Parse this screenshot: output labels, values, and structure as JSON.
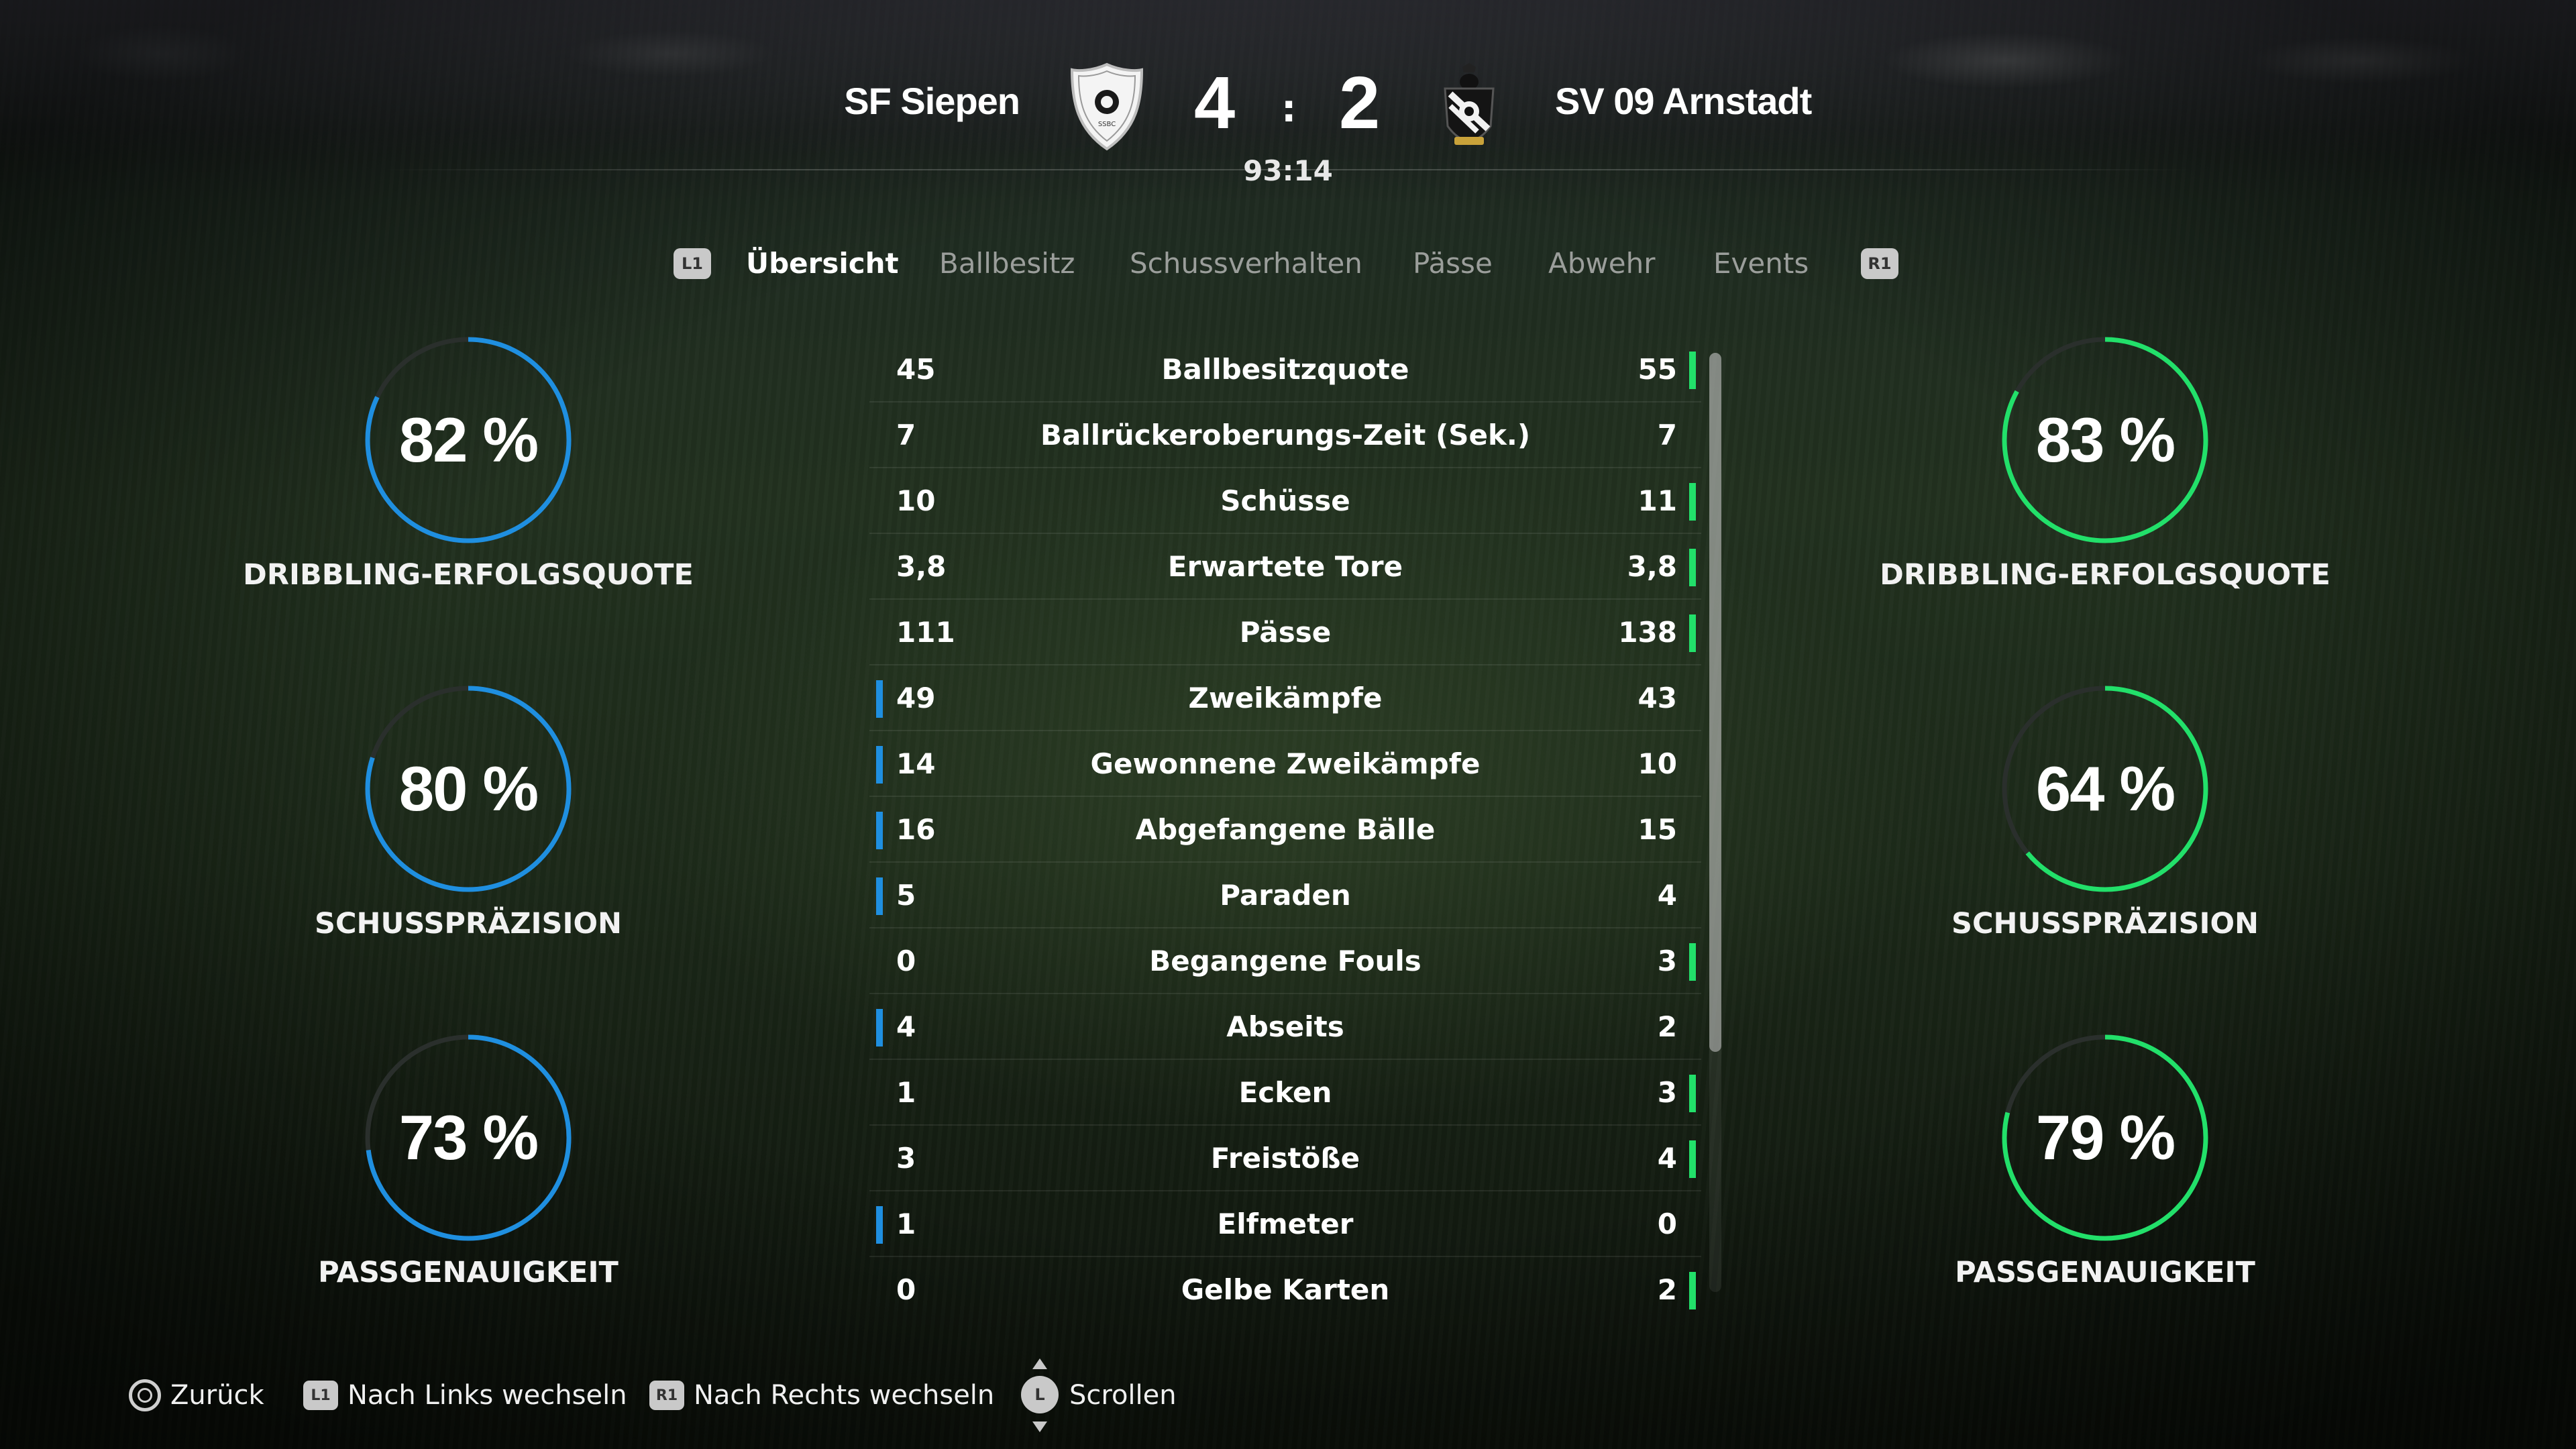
{
  "match": {
    "home_team": "SF Siepen",
    "away_team": "SV 09 Arnstadt",
    "home_score": "4",
    "away_score": "2",
    "separator": ":",
    "clock": "93:14"
  },
  "tabs": {
    "left_button": "L1",
    "right_button": "R1",
    "items": [
      "Übersicht",
      "Ballbesitz",
      "Schussverhalten",
      "Pässe",
      "Abwehr",
      "Events"
    ],
    "active": "Übersicht"
  },
  "home_rings": [
    {
      "value": "82 %",
      "percent": 82,
      "label": "DRIBBLING-ERFOLGSQUOTE"
    },
    {
      "value": "80 %",
      "percent": 80,
      "label": "SCHUSSPRÄZISION"
    },
    {
      "value": "73 %",
      "percent": 73,
      "label": "PASSGENAUIGKEIT"
    }
  ],
  "away_rings": [
    {
      "value": "83 %",
      "percent": 83,
      "label": "DRIBBLING-ERFOLGSQUOTE"
    },
    {
      "value": "64 %",
      "percent": 64,
      "label": "SCHUSSPRÄZISION"
    },
    {
      "value": "79 %",
      "percent": 79,
      "label": "PASSGENAUIGKEIT"
    }
  ],
  "stats": [
    {
      "home": "45",
      "label": "Ballbesitzquote",
      "away": "55",
      "leader": "away"
    },
    {
      "home": "7",
      "label": "Ballrückeroberungs-Zeit (Sek.)",
      "away": "7",
      "leader": "none"
    },
    {
      "home": "10",
      "label": "Schüsse",
      "away": "11",
      "leader": "away"
    },
    {
      "home": "3,8",
      "label": "Erwartete Tore",
      "away": "3,8",
      "leader": "away"
    },
    {
      "home": "111",
      "label": "Pässe",
      "away": "138",
      "leader": "away"
    },
    {
      "home": "49",
      "label": "Zweikämpfe",
      "away": "43",
      "leader": "home"
    },
    {
      "home": "14",
      "label": "Gewonnene Zweikämpfe",
      "away": "10",
      "leader": "home"
    },
    {
      "home": "16",
      "label": "Abgefangene Bälle",
      "away": "15",
      "leader": "home"
    },
    {
      "home": "5",
      "label": "Paraden",
      "away": "4",
      "leader": "home"
    },
    {
      "home": "0",
      "label": "Begangene Fouls",
      "away": "3",
      "leader": "away"
    },
    {
      "home": "4",
      "label": "Abseits",
      "away": "2",
      "leader": "home"
    },
    {
      "home": "1",
      "label": "Ecken",
      "away": "3",
      "leader": "away"
    },
    {
      "home": "3",
      "label": "Freistöße",
      "away": "4",
      "leader": "away"
    },
    {
      "home": "1",
      "label": "Elfmeter",
      "away": "0",
      "leader": "home"
    },
    {
      "home": "0",
      "label": "Gelbe Karten",
      "away": "2",
      "leader": "away"
    }
  ],
  "footer": {
    "back_label": "Zurück",
    "l1_badge": "L1",
    "left_label": "Nach Links wechseln",
    "r1_badge": "R1",
    "right_label": "Nach Rechts wechseln",
    "stick_badge": "L",
    "scroll_label": "Scrollen"
  },
  "colors": {
    "home_accent": "#1f8fe0",
    "away_accent": "#22e06a",
    "ring_track": "#2a2f2c"
  }
}
